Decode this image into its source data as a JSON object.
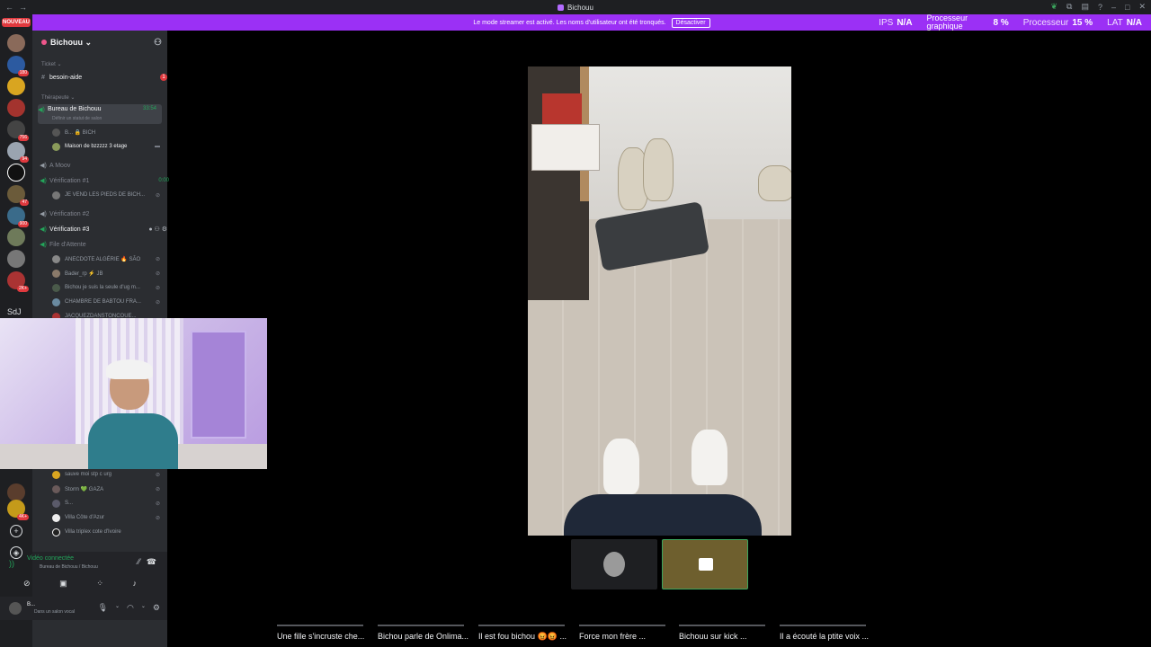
{
  "window": {
    "title": "Bichouu",
    "nav_back": "←",
    "nav_forward": "→"
  },
  "banner": {
    "message": "Le mode streamer est activé. Les noms d'utilisateur ont été tronqués.",
    "button": "Désactiver"
  },
  "stats": {
    "fps_label": "IPS",
    "fps_value": "N/A",
    "gpu_label": "Processeur graphique",
    "gpu_value": "8 %",
    "cpu_label": "Processeur",
    "cpu_value": "15 %",
    "lat_label": "LAT",
    "lat_value": "N/A"
  },
  "rail": {
    "new_badge": "NOUVEAU",
    "badges": [
      "180",
      "756",
      "94",
      "47",
      "900",
      "2K+",
      "4K+"
    ],
    "folder_label": "SdJ",
    "add_icon": "plus-icon",
    "discover_icon": "compass-icon"
  },
  "guild": {
    "name": "Bichouu ⌄"
  },
  "sidebar": {
    "cat_ticket": "Ticket ⌄",
    "ch_besoin": "besoin-aide",
    "ch_besoin_badge": "1",
    "cat_therapeute": "Thérapeute ⌄",
    "ch_bureau": "Bureau de Bichouu",
    "ch_bureau_timer": "33:54",
    "ch_bureau_status": "Définir un statut de salon",
    "u_b": "B... 🔒 BICH",
    "u_maison": "Maison de bzzzzz 3 etage",
    "ch_amoov": "A Moov",
    "ch_verif1": "Vérification #1",
    "ch_verif1_timer": "0:00",
    "u_jevend": "JE VEND LES PIEDS DE BICH...",
    "ch_verif2": "Vérification #2",
    "ch_verif3": "Vérification #3",
    "ch_file": "File d'Attente",
    "u_anecdote": "ANECDOTE ALGÉRIE 🔥 SÃO",
    "u_bader": "Bader_rp ⚡ JB",
    "u_bichou": "Bichou je suis la seule d'ug m...",
    "u_chambre": "CHAMBRE DE BABTOU FRA...",
    "u_jacquez": "JACQUEZDANSTONCOUE...",
    "u_sauve": "sauve moi stp c urg",
    "u_storm": "Storm 💚 GAZA",
    "u_s": "S...",
    "u_villa": "Villa Côte d'Azur",
    "u_villa2": "Villa triplex cote d'Ivoire"
  },
  "voice": {
    "status": "Vidéo connectée",
    "location": "Bureau de Bichouu / Bichouu"
  },
  "account": {
    "name": "B...",
    "status": "Dans un salon vocal"
  },
  "clips": [
    "Une fille s'incruste che...",
    "Bichou parle de Onlima...",
    "Il est fou bichou 😡😡 ...",
    "Force mon frère ...",
    "Bichouu sur kick ...",
    "Il a écouté la ptite voix ..."
  ],
  "colors": {
    "accent": "#9b30f5",
    "voice_green": "#23a55a",
    "alert_red": "#e0393e"
  }
}
